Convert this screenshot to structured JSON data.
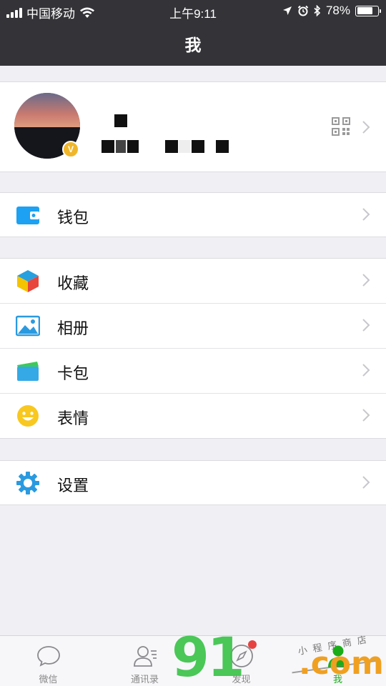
{
  "status_bar": {
    "carrier": "中国移动",
    "time": "上午9:11",
    "battery": "78%",
    "battery_level": 0.78
  },
  "nav": {
    "title": "我"
  },
  "profile": {
    "verified_badge": "V"
  },
  "menu": {
    "wallet": "钱包",
    "favorites": "收藏",
    "album": "相册",
    "cards": "卡包",
    "stickers": "表情",
    "settings": "设置"
  },
  "tabs": [
    {
      "label": "微信",
      "icon": "chat-bubble-icon"
    },
    {
      "label": "通讯录",
      "icon": "contacts-icon"
    },
    {
      "label": "发现",
      "icon": "compass-icon"
    },
    {
      "label": "我",
      "icon": "person-icon"
    }
  ],
  "watermark": {
    "main": "91",
    "domain": ".com",
    "subtitle": "小程序商店"
  },
  "colors": {
    "nav_bg": "#343438",
    "page_bg": "#efeff4",
    "accent_green": "#1aad19",
    "badge_yellow": "#f0b62a",
    "wallet_blue": "#1da1f2",
    "notification_red": "#e64340"
  }
}
